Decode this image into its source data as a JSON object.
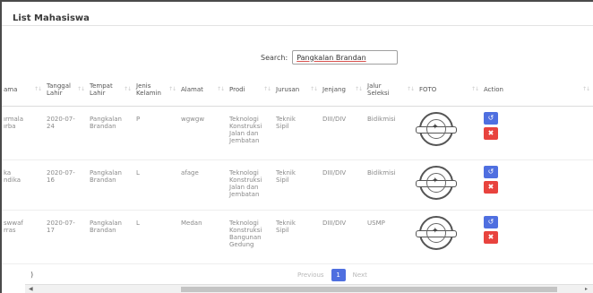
{
  "header": {
    "title": "List Mahasiswa"
  },
  "search": {
    "label": "Search:",
    "value": "Pangkalan Brandan"
  },
  "table": {
    "columns": [
      {
        "label": "ama"
      },
      {
        "label": "Tanggal\nLahir"
      },
      {
        "label": "Tempat\nLahir"
      },
      {
        "label": "Jenis\nKelamin"
      },
      {
        "label": "Alamat"
      },
      {
        "label": "Prodi"
      },
      {
        "label": "Jurusan"
      },
      {
        "label": "Jenjang"
      },
      {
        "label": "Jalur\nSeleksi"
      },
      {
        "label": "FOTO"
      },
      {
        "label": "Action"
      }
    ],
    "rows": [
      {
        "nama": "ırmala\nırba",
        "tanggal": "2020-07-\n24",
        "tempat": "Pangkalan\nBrandan",
        "jk": "P",
        "alamat": "wgwgw",
        "prodi": "Teknologi\nKonstruksi\nJalan dan\nJembatan",
        "jurusan": "Teknik\nSipil",
        "jenjang": "DIII/DIV",
        "jalur": "Bidikmisi"
      },
      {
        "nama": "ka\nndika",
        "tanggal": "2020-07-\n16",
        "tempat": "Pangkalan\nBrandan",
        "jk": "L",
        "alamat": "afage",
        "prodi": "Teknologi\nKonstruksi\nJalan dan\nJembatan",
        "jurusan": "Teknik\nSipil",
        "jenjang": "DIII/DIV",
        "jalur": "Bidikmisi"
      },
      {
        "nama": "swwaf\nrras",
        "tanggal": "2020-07-\n17",
        "tempat": "Pangkalan\nBrandan",
        "jk": "L",
        "alamat": "Medan",
        "prodi": "Teknologi\nKonstruksi\nBangunan\nGedung",
        "jurusan": "Teknik\nSipil",
        "jenjang": "DIII/DIV",
        "jalur": "USMP"
      }
    ],
    "sort_icon": "↑↓",
    "edit_icon": "↺",
    "delete_icon": "✖"
  },
  "footer": {
    "info_fragment": ")",
    "prev_label": "Previous",
    "current_page": "1",
    "next_label": "Next"
  },
  "colors": {
    "primary": "#4f6fe0",
    "danger": "#e8433e"
  }
}
